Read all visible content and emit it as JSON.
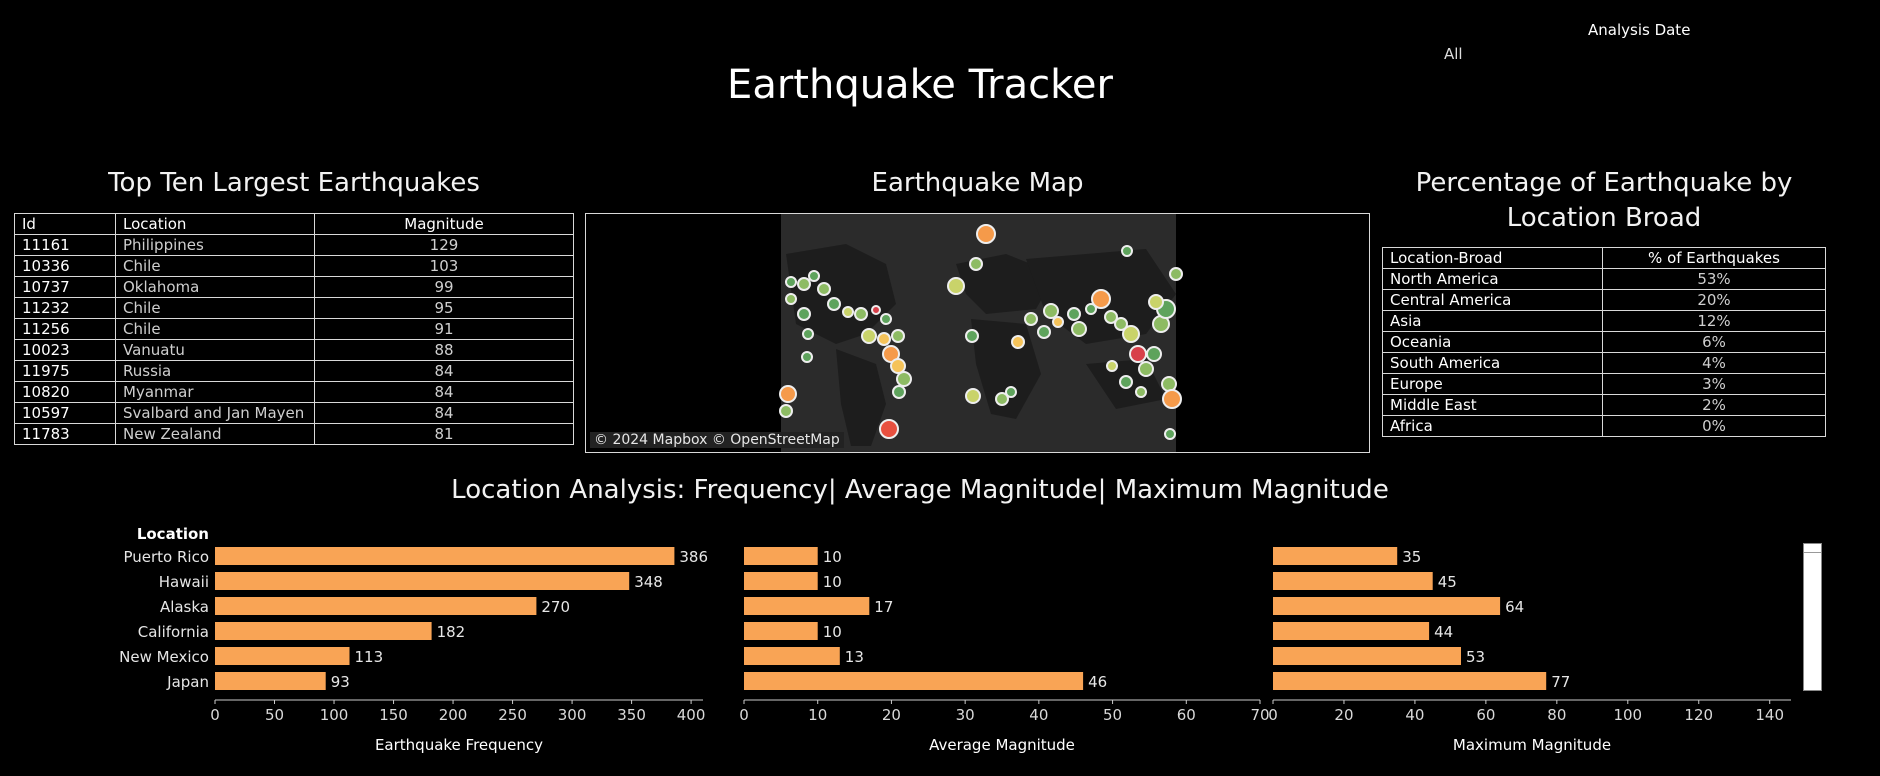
{
  "filter": {
    "label": "Analysis Date",
    "value": "All"
  },
  "title": "Earthquake Tracker",
  "top_ten": {
    "title": "Top Ten Largest Earthquakes",
    "headers": [
      "Id",
      "Location",
      "Magnitude"
    ],
    "rows": [
      {
        "id": "11161",
        "location": "Philippines",
        "magnitude": "129"
      },
      {
        "id": "10336",
        "location": "Chile",
        "magnitude": "103"
      },
      {
        "id": "10737",
        "location": "Oklahoma",
        "magnitude": "99"
      },
      {
        "id": "11232",
        "location": "Chile",
        "magnitude": "95"
      },
      {
        "id": "11256",
        "location": "Chile",
        "magnitude": "91"
      },
      {
        "id": "10023",
        "location": "Vanuatu",
        "magnitude": "88"
      },
      {
        "id": "11975",
        "location": "Russia",
        "magnitude": "84"
      },
      {
        "id": "10820",
        "location": "Myanmar",
        "magnitude": "84"
      },
      {
        "id": "10597",
        "location": "Svalbard and Jan Mayen",
        "magnitude": "84"
      },
      {
        "id": "11783",
        "location": "New Zealand",
        "magnitude": "81"
      }
    ]
  },
  "map": {
    "title": "Earthquake Map",
    "attribution": "© 2024 Mapbox © OpenStreetMap"
  },
  "percent": {
    "title_line1": "Percentage of Earthquake by",
    "title_line2": "Location Broad",
    "headers": [
      "Location-Broad",
      "% of  Earthquakes"
    ],
    "rows": [
      {
        "region": "North America",
        "pct": "53%"
      },
      {
        "region": "Central America",
        "pct": "20%"
      },
      {
        "region": "Asia",
        "pct": "12%"
      },
      {
        "region": "Oceania",
        "pct": "6%"
      },
      {
        "region": "South America",
        "pct": "4%"
      },
      {
        "region": "Europe",
        "pct": "3%"
      },
      {
        "region": "Middle East",
        "pct": "2%"
      },
      {
        "region": "Africa",
        "pct": "0%"
      }
    ]
  },
  "chart_data": {
    "type": "bar",
    "title": "Location Analysis: Frequency| Average Magnitude| Maximum Magnitude",
    "row_header": "Location",
    "categories": [
      "Puerto Rico",
      "Hawaii",
      "Alaska",
      "California",
      "New Mexico",
      "Japan"
    ],
    "bar_color": "#f9a455",
    "series": [
      {
        "name": "Earthquake Frequency",
        "values": [
          386,
          348,
          270,
          182,
          113,
          93
        ],
        "ticks": [
          0,
          50,
          100,
          150,
          200,
          250,
          300,
          350,
          400
        ],
        "xlim": [
          0,
          410
        ]
      },
      {
        "name": "Average Magnitude",
        "values": [
          10,
          10,
          17,
          10,
          13,
          46
        ],
        "ticks": [
          0,
          10,
          20,
          30,
          40,
          50,
          60,
          70
        ],
        "xlim": [
          0,
          70
        ]
      },
      {
        "name": "Maximum Magnitude",
        "values": [
          35,
          45,
          64,
          44,
          53,
          77
        ],
        "ticks": [
          0,
          20,
          40,
          60,
          80,
          100,
          120,
          140
        ],
        "xlim": [
          0,
          146
        ]
      }
    ]
  }
}
